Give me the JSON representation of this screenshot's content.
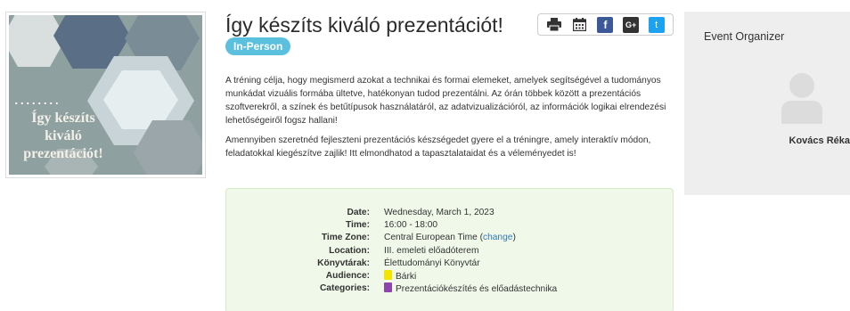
{
  "event": {
    "title": "Így készíts kiváló prezentációt!",
    "badge": "In-Person",
    "description": [
      "A tréning célja, hogy megismerd azokat a technikai és formai elemeket, amelyek segítségével a tudományos munkádat vizuális formába ültetve, hatékonyan tudod prezentálni. Az órán többek között a prezentációs szoftverekről, a színek és betűtípusok használatáról, az adatvizualizációról, az információk logikai elrendezési lehetőségeiről fogsz hallani!",
      "Amennyiben szeretnéd fejleszteni prezentációs készségedet gyere el a tréningre, amely interaktív módon, feladatokkal kiegészítve zajlik! Itt elmondhatod a tapasztalataidat és a véleményedet is!"
    ]
  },
  "thumbnail": {
    "dots": "........",
    "text": "Így készíts kiváló prezentációt!"
  },
  "share": {
    "icons": [
      "print-icon",
      "calendar-icon",
      "facebook-icon",
      "google-plus-icon",
      "twitter-icon"
    ],
    "facebook_glyph": "f",
    "google_glyph": "G+",
    "twitter_glyph": "t"
  },
  "details": {
    "date_label": "Date:",
    "date_value": "Wednesday, March 1, 2023",
    "time_label": "Time:",
    "time_value": "16:00 - 18:00",
    "timezone_label": "Time Zone:",
    "timezone_value": "Central European Time",
    "timezone_change": "change",
    "location_label": "Location:",
    "location_value": "III. emeleti előadóterem",
    "library_label": "Könyvtárak:",
    "library_value": "Élettudományi Könyvtár",
    "audience_label": "Audience:",
    "audience_value": "Bárki",
    "audience_color": "#f2e600",
    "categories_label": "Categories:",
    "categories_value": "Prezentációkészítés és előadástechnika",
    "categories_color": "#8e44ad"
  },
  "organizer": {
    "heading": "Event Organizer",
    "name": "Kovács Réka"
  },
  "colors": {
    "badge": "#5bc0de",
    "details_bg": "#eff8e9",
    "sidebar_bg": "#eeeeee",
    "link": "#337ab7"
  }
}
